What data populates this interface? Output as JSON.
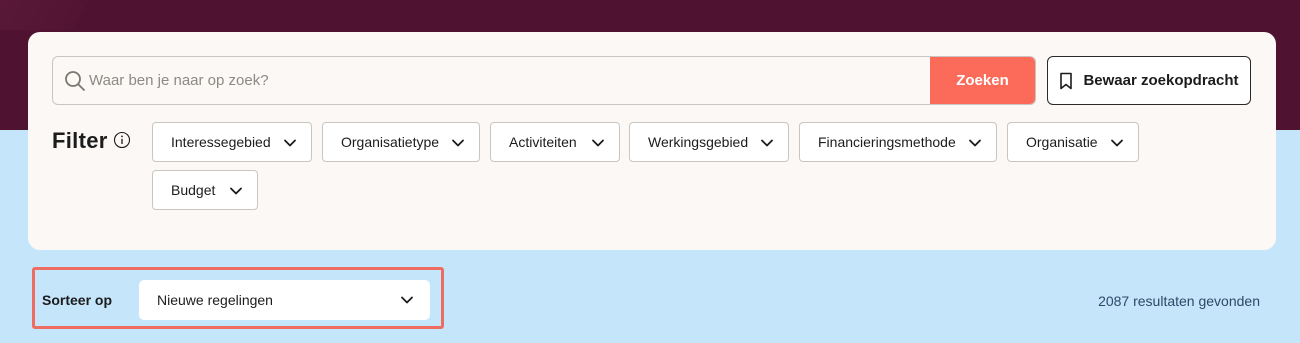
{
  "search": {
    "placeholder": "Waar ben je naar op zoek?",
    "value": "",
    "button_label": "Zoeken"
  },
  "save_search": {
    "label": "Bewaar zoekopdracht",
    "icon": "bookmark-icon"
  },
  "filter": {
    "label": "Filter",
    "info_icon": "info-icon",
    "chips": [
      {
        "label": "Interessegebied"
      },
      {
        "label": "Organisatietype"
      },
      {
        "label": "Activiteiten"
      },
      {
        "label": "Werkingsgebied"
      },
      {
        "label": "Financieringsmethode"
      },
      {
        "label": "Organisatie"
      },
      {
        "label": "Budget"
      }
    ]
  },
  "sort": {
    "label": "Sorteer op",
    "selected": "Nieuwe regelingen"
  },
  "results": {
    "count_text": "2087 resultaten gevonden"
  },
  "colors": {
    "header_band": "#4f1230",
    "page_background": "#c5e5fb",
    "card_background": "#fbf8f5",
    "search_button": "#fc6b5a",
    "highlight_outline": "#ee6c62"
  }
}
